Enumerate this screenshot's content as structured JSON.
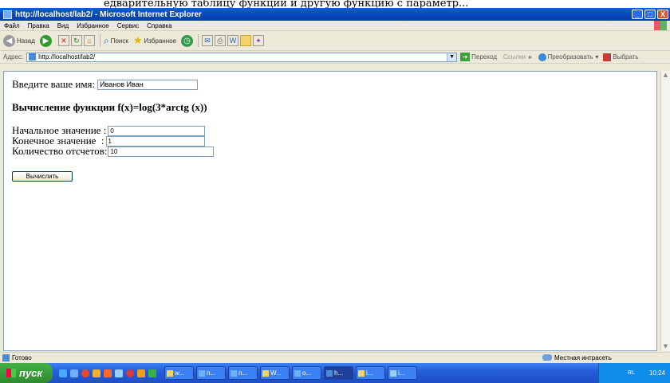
{
  "caption_text": "едварительную таблицу функции и другую функцию с параметр...",
  "window": {
    "title": "http://localhost/lab2/ - Microsoft Internet Explorer",
    "buttons": {
      "minimize": "_",
      "maximize": "□",
      "close": "X"
    }
  },
  "menu": [
    "Файл",
    "Правка",
    "Вид",
    "Избранное",
    "Сервис",
    "Справка"
  ],
  "toolbar": {
    "back": "Назад",
    "search": "Поиск",
    "favorites": "Избранное"
  },
  "address": {
    "label": "Адрес:",
    "value": "http://localhost/lab2/",
    "go": "Переход",
    "links": "Ссылки",
    "convert": "Преобразовать",
    "select": "Выбрать"
  },
  "page": {
    "name_label": "Введите ваше имя:",
    "name_value": "Иванов Иван",
    "heading": "Вычисление функции f(x)=log(3*arctg (x))",
    "start_label": "Начальное значение :",
    "start_value": "0",
    "end_label": "Конечное значение  :",
    "end_value": "1",
    "count_label": "Количество отсчетов:",
    "count_value": "10",
    "calc_button": "Вычислить"
  },
  "status": {
    "text": "Готово",
    "zone": "Местная интрасеть"
  },
  "taskbar": {
    "start": "пуск",
    "tasks": [
      "w...",
      "п...",
      "п...",
      "W...",
      "о...",
      "h...",
      "l...",
      "i..."
    ],
    "lang": "RL",
    "clock": "10:24"
  }
}
